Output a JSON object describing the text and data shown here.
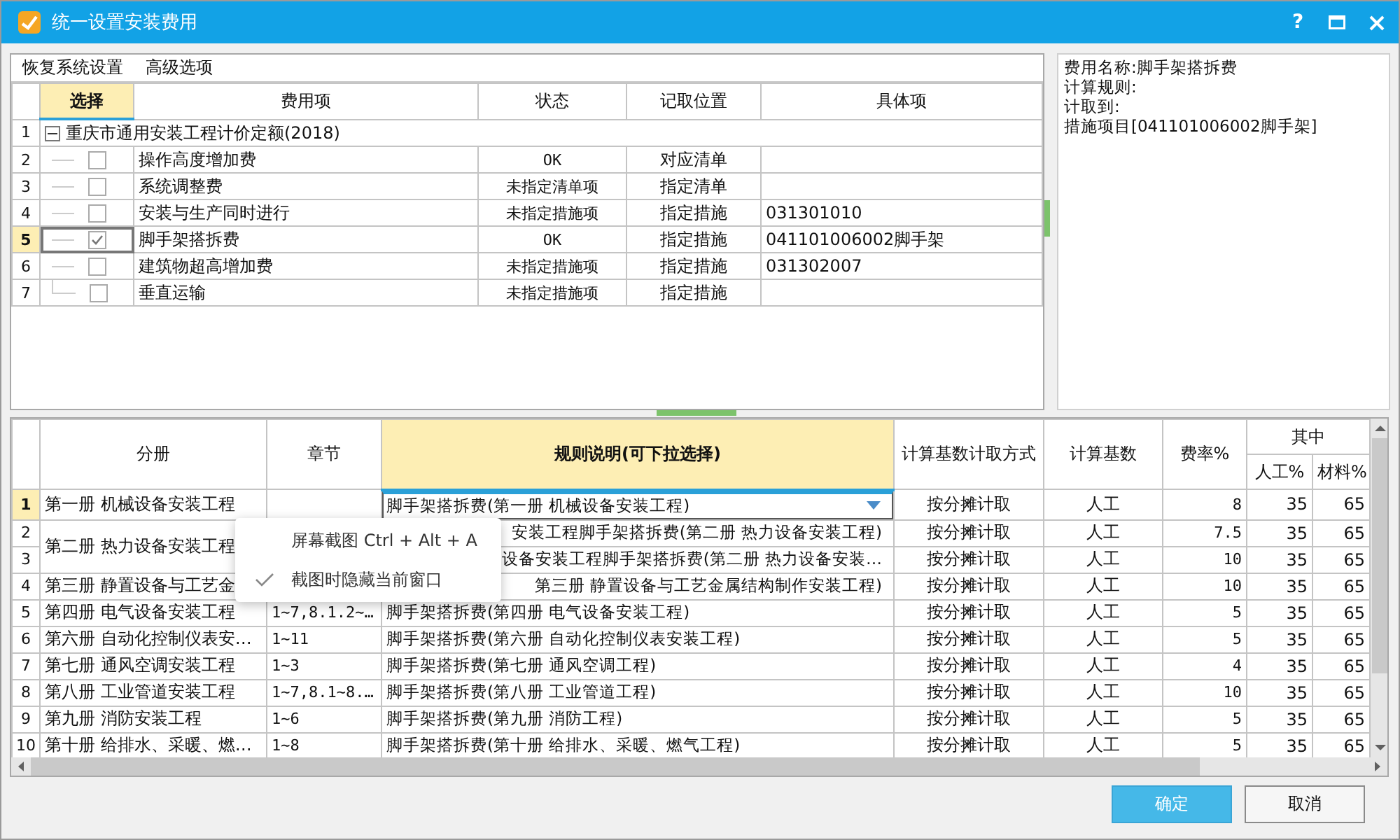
{
  "window": {
    "title": "统一设置安装费用",
    "help": "?"
  },
  "toolbar": [
    "恢复系统设置",
    "高级选项"
  ],
  "top_table": {
    "columns": [
      {
        "label": "选择",
        "highlighted": true
      },
      {
        "label": "费用项",
        "highlighted": false
      },
      {
        "label": "状态",
        "highlighted": false
      },
      {
        "label": "记取位置",
        "highlighted": false
      },
      {
        "label": "具体项",
        "highlighted": false
      }
    ],
    "rows": [
      {
        "num": "1",
        "kind": "group",
        "label": "重庆市通用安装工程计价定额(2018)",
        "expanded": true,
        "selected": false
      },
      {
        "num": "2",
        "kind": "item",
        "checked": false,
        "selected": false,
        "name": "操作高度增加费",
        "status": "OK",
        "location": "对应清单"
      },
      {
        "num": "3",
        "kind": "item",
        "checked": false,
        "selected": false,
        "name": "系统调整费",
        "status": "未指定清单项",
        "location": "指定清单"
      },
      {
        "num": "4",
        "kind": "item",
        "checked": false,
        "selected": false,
        "name": "安装与生产同时进行",
        "status": "未指定措施项",
        "location": "指定措施",
        "detail": "031301010"
      },
      {
        "num": "5",
        "kind": "item",
        "checked": true,
        "selected": true,
        "name": "脚手架搭拆费",
        "status": "OK",
        "location": "指定措施",
        "detail": "041101006002脚手架"
      },
      {
        "num": "6",
        "kind": "item",
        "checked": false,
        "selected": false,
        "name": "建筑物超高增加费",
        "status": "未指定措施项",
        "location": "指定措施",
        "detail": "031302007"
      },
      {
        "num": "7",
        "kind": "item",
        "checked": false,
        "selected": false,
        "name": "垂直运输",
        "status": "未指定措施项",
        "location": "指定措施"
      }
    ]
  },
  "info_panel": [
    "费用名称:脚手架搭拆费",
    "计算规则:",
    "计取到:",
    "措施项目[041101006002脚手架]"
  ],
  "bottom_table": {
    "columns": [
      {
        "label": "分册",
        "highlighted": false
      },
      {
        "label": "章节",
        "highlighted": false
      },
      {
        "label": "规则说明(可下拉选择)",
        "highlighted": true
      },
      {
        "label": "计算基数计取方式",
        "highlighted": false
      },
      {
        "label": "计算基数",
        "highlighted": false
      },
      {
        "label": "费率%",
        "highlighted": false
      }
    ],
    "group_header": {
      "label": "其中",
      "columns": [
        "人工%",
        "材料%"
      ]
    },
    "rows": [
      {
        "num": "1",
        "selected": true,
        "covered": false,
        "volume": "第一册 机械设备安装工程",
        "rule": "脚手架搭拆费(第一册 机械设备安装工程)",
        "method": "按分摊计取",
        "base": "人工",
        "rate": "8",
        "labor": "35",
        "material": "65"
      },
      {
        "num": "2",
        "selected": false,
        "covered": true,
        "volume": "第二册 热力设备安装工程",
        "volume_merged": true,
        "rule": "安装工程脚手架搭拆费(第二册 热力设备安装工程)",
        "method": "按分摊计取",
        "base": "人工",
        "rate": "7.5",
        "labor": "35",
        "material": "65"
      },
      {
        "num": "3",
        "selected": false,
        "covered": true,
        "rule": "设备安装工程脚手架搭拆费(第二册 热力设备安装…",
        "method": "按分摊计取",
        "base": "人工",
        "rate": "10",
        "labor": "35",
        "material": "65"
      },
      {
        "num": "4",
        "selected": false,
        "covered": true,
        "volume": "第三册 静置设备与工艺金",
        "rule": "第三册 静置设备与工艺金属结构制作安装工程)",
        "method": "按分摊计取",
        "base": "人工",
        "rate": "10",
        "labor": "35",
        "material": "65"
      },
      {
        "num": "5",
        "selected": false,
        "covered": false,
        "volume": "第四册 电气设备安装工程",
        "chapter": "1~7,8.1.2~…",
        "rule": "脚手架搭拆费(第四册 电气设备安装工程)",
        "method": "按分摊计取",
        "base": "人工",
        "rate": "5",
        "labor": "35",
        "material": "65"
      },
      {
        "num": "6",
        "selected": false,
        "covered": false,
        "volume": "第六册 自动化控制仪表安…",
        "chapter": "1~11",
        "rule": "脚手架搭拆费(第六册 自动化控制仪表安装工程)",
        "method": "按分摊计取",
        "base": "人工",
        "rate": "5",
        "labor": "35",
        "material": "65"
      },
      {
        "num": "7",
        "selected": false,
        "covered": false,
        "volume": "第七册 通风空调安装工程",
        "chapter": "1~3",
        "rule": "脚手架搭拆费(第七册 通风空调工程)",
        "method": "按分摊计取",
        "base": "人工",
        "rate": "4",
        "labor": "35",
        "material": "65"
      },
      {
        "num": "8",
        "selected": false,
        "covered": false,
        "volume": "第八册 工业管道安装工程",
        "chapter": "1~7,8.1~8.…",
        "rule": "脚手架搭拆费(第八册 工业管道工程)",
        "method": "按分摊计取",
        "base": "人工",
        "rate": "10",
        "labor": "35",
        "material": "65"
      },
      {
        "num": "9",
        "selected": false,
        "covered": false,
        "volume": "第九册 消防安装工程",
        "chapter": "1~6",
        "rule": "脚手架搭拆费(第九册 消防工程)",
        "method": "按分摊计取",
        "base": "人工",
        "rate": "5",
        "labor": "35",
        "material": "65"
      },
      {
        "num": "10",
        "selected": false,
        "covered": false,
        "volume": "第十册 给排水、采暖、燃…",
        "chapter": "1~8",
        "rule": "脚手架搭拆费(第十册 给排水、采暖、燃气工程)",
        "method": "按分摊计取",
        "base": "人工",
        "rate": "5",
        "labor": "35",
        "material": "65"
      }
    ]
  },
  "context_menu": [
    {
      "label": "屏幕截图 Ctrl + Alt + A",
      "checked": false
    },
    {
      "label": "截图时隐藏当前窗口",
      "checked": true
    }
  ],
  "buttons": [
    {
      "label": "确定",
      "primary": true
    },
    {
      "label": "取消",
      "primary": false
    }
  ]
}
